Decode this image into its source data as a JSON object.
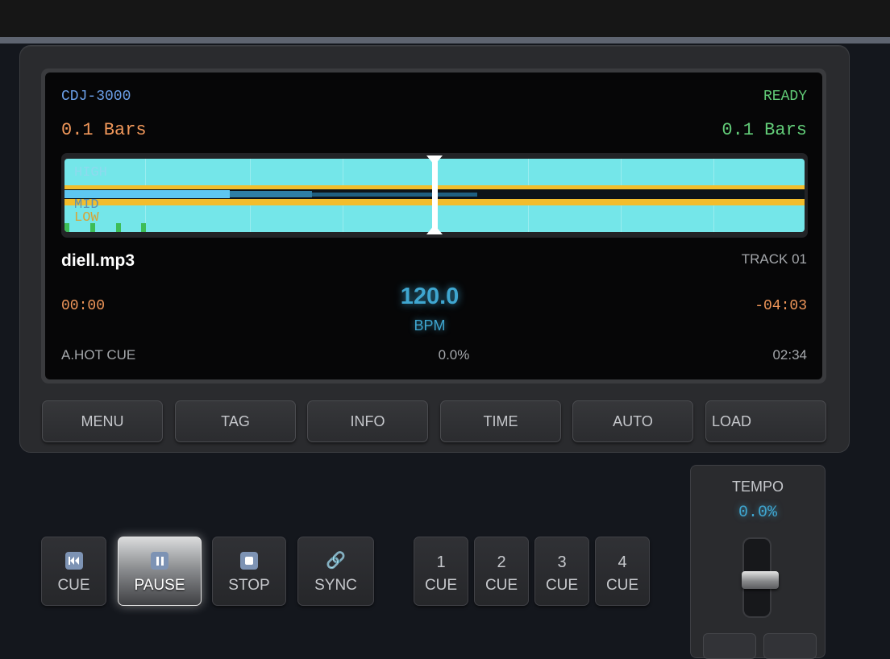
{
  "screen": {
    "model": "CDJ-3000",
    "status": "READY",
    "bars_left": "0.1 Bars",
    "bars_right": "0.1 Bars",
    "waveform": {
      "labels": {
        "high": "HIGH",
        "mid": "MID",
        "low": "LOW"
      },
      "colors": {
        "high": "#74e6e9",
        "mid_low": "#f2bd2c",
        "progress": "#5ec7f2",
        "beat_marker": "#3dbd57"
      }
    },
    "track_name": "diell.mp3",
    "track_number": "TRACK 01",
    "time_elapsed": "00:00",
    "time_remaining": "-04:03",
    "bpm_value": "120.0",
    "bpm_label": "BPM",
    "mode_label": "A.HOT CUE",
    "pitch_percent": "0.0%",
    "cue_time": "02:34"
  },
  "menu_buttons": [
    "MENU",
    "TAG",
    "INFO",
    "TIME",
    "AUTO",
    "LOAD"
  ],
  "transport": {
    "cue": {
      "label": "CUE",
      "icon": "skip-back-icon"
    },
    "pause": {
      "label": "PAUSE",
      "icon": "pause-icon",
      "active": true
    },
    "stop": {
      "label": "STOP",
      "icon": "stop-icon"
    },
    "sync": {
      "label": "SYNC",
      "icon": "link-icon",
      "glyph": "🔗"
    }
  },
  "hot_cues": [
    {
      "number": "1",
      "label": "CUE"
    },
    {
      "number": "2",
      "label": "CUE"
    },
    {
      "number": "3",
      "label": "CUE"
    },
    {
      "number": "4",
      "label": "CUE"
    }
  ],
  "tempo": {
    "title": "TEMPO",
    "value": "0.0%"
  },
  "accent_colors": {
    "orange": "#f0975a",
    "green": "#62cc78",
    "blue": "#3fa6d0",
    "model_blue": "#6a9ee6"
  }
}
